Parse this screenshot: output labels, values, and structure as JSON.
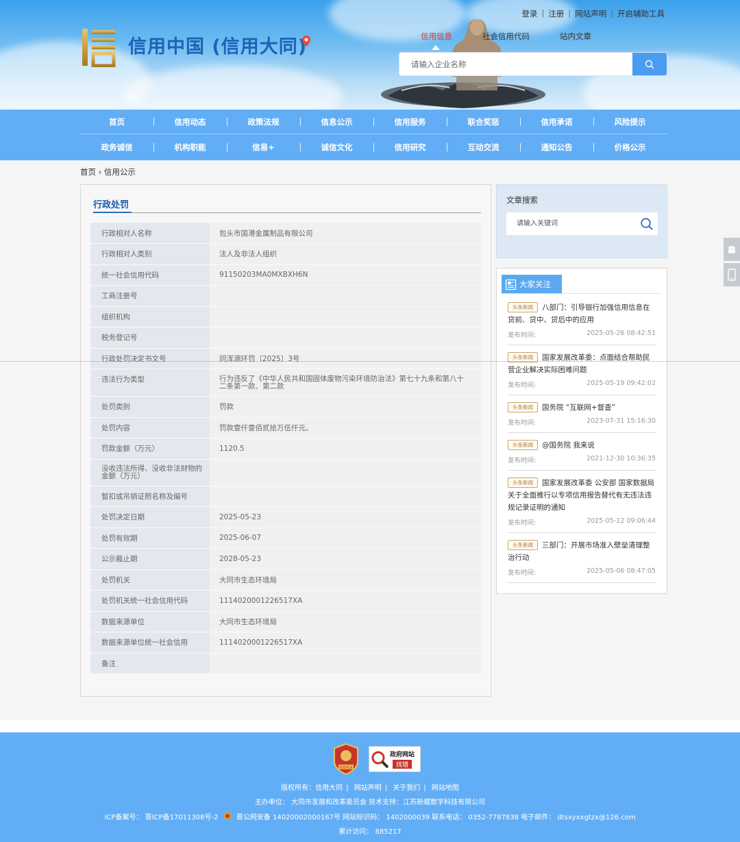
{
  "header": {
    "logo_char": "信",
    "site_title": "信用中国 (信用大同)",
    "top_links": [
      "登录",
      "注册",
      "网站声明",
      "开启辅助工具"
    ],
    "search_tabs": [
      "信用信息",
      "社会信用代码",
      "站内文章"
    ],
    "active_tab": "信用信息",
    "search_placeholder": "请输入企业名称"
  },
  "nav": {
    "row1": [
      "首页",
      "信用动态",
      "政策法规",
      "信息公示",
      "信用服务",
      "联合奖惩",
      "信用承诺",
      "风险提示"
    ],
    "row2": [
      "政务诚信",
      "机构职能",
      "信易+",
      "诚信文化",
      "信用研究",
      "互动交流",
      "通知公告",
      "价格公示"
    ]
  },
  "breadcrumb": {
    "home": "首页",
    "sep": "›",
    "current": "信用公示"
  },
  "detail": {
    "title": "行政处罚",
    "rows": [
      {
        "k": "行政相对人名称",
        "v": "包头市国港金属制品有限公司"
      },
      {
        "k": "行政相对人类别",
        "v": "法人及非法人组织"
      },
      {
        "k": "统一社会信用代码",
        "v": "91150203MA0MXBXH6N"
      },
      {
        "k": "工商注册号",
        "v": ""
      },
      {
        "k": "组织机构",
        "v": ""
      },
      {
        "k": "税务登记号",
        "v": ""
      },
      {
        "k": "行政处罚决定书文号",
        "v": "同浑源环罚〔2025〕3号"
      },
      {
        "k": "违法行为类型",
        "v": "行为违反了《中华人民共和国固体废物污染环境防治法》第七十九条和第八十二条第一款、第二款"
      },
      {
        "k": "处罚类别",
        "v": "罚款"
      },
      {
        "k": "处罚内容",
        "v": "罚款壹仟壹佰贰拾万伍仟元。"
      },
      {
        "k": "罚款金额（万元）",
        "v": "1120.5"
      },
      {
        "k": "没收违法所得、没收非法财物的金额（万元）",
        "v": ""
      },
      {
        "k": "暂扣或吊销证照名称及编号",
        "v": ""
      },
      {
        "k": "处罚决定日期",
        "v": "2025-05-23"
      },
      {
        "k": "处罚有效期",
        "v": "2025-06-07"
      },
      {
        "k": "公示截止期",
        "v": "2028-05-23"
      },
      {
        "k": "处罚机关",
        "v": "大同市生态环境局"
      },
      {
        "k": "处罚机关统一社会信用代码",
        "v": "1114020001226517XA"
      },
      {
        "k": "数据来源单位",
        "v": "大同市生态环境局"
      },
      {
        "k": "数据来源单位统一社会信用",
        "v": "1114020001226517XA"
      },
      {
        "k": "备注",
        "v": ""
      }
    ]
  },
  "sidebar": {
    "search_title": "文章搜索",
    "search_placeholder": "请输入关键词",
    "focus_title": "大家关注",
    "news_tag": "头条新闻",
    "date_label": "发布时间:",
    "news": [
      {
        "title": "八部门：引导银行加强信用信息在贷前、贷中、贷后中的应用",
        "date": "2025-05-26 08:42:51"
      },
      {
        "title": "国家发展改革委：点面结合帮助民营企业解决实际困难问题",
        "date": "2025-05-19 09:42:02"
      },
      {
        "title": "国务院 “互联网+督查”",
        "date": "2023-07-31 15:16:30"
      },
      {
        "title": "@国务院 我来说",
        "date": "2021-12-30 10:36:35"
      },
      {
        "title": "国家发展改革委 公安部 国家数据局关于全面推行以专项信用报告替代有无违法违规记录证明的通知",
        "date": "2025-05-12 09:06:44"
      },
      {
        "title": "三部门：开展市场准入壁垒清理整治行动",
        "date": "2025-05-06 08:47:05"
      }
    ]
  },
  "footer": {
    "gov_badge_text": "党政机关",
    "err_badge_top": "政府网站",
    "err_badge_bottom": "找错",
    "links": [
      "版权所有：信用大同",
      "网站声明",
      "关于我们",
      "网站地图"
    ],
    "host": "主办单位：  大同市发展和改革委员会  技术支持：江苏新蝶数字科技有限公司",
    "icp": "ICP备案号：  晋ICP备17011308号-2",
    "police": "晋公网安备 14020002000167号 网站标识码：  1402000039 联系电话：  0352-7787838  电子邮件：  dtsxyxxgtzx@126.com",
    "visits": "累计访问：  885217"
  },
  "colors": {
    "nav_bg": "#62aef6",
    "title_blue": "#1b64b8",
    "active_red": "#d83b2f",
    "tag_gold": "#b07c3a"
  }
}
